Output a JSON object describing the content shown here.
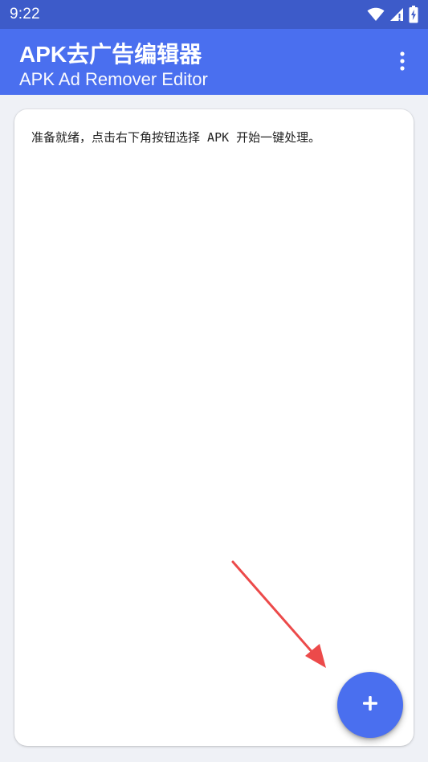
{
  "status_bar": {
    "time": "9:22",
    "icons": [
      "wifi-icon",
      "cellular-signal-icon",
      "battery-charging-icon"
    ]
  },
  "app_bar": {
    "title": "APK去广告编辑器",
    "subtitle": "APK Ad Remover Editor",
    "menu_icon": "more-vert-icon"
  },
  "main": {
    "status_message": "准备就绪，点击右下角按钮选择 APK 开始一键处理。"
  },
  "fab": {
    "icon": "plus-icon"
  },
  "colors": {
    "status_bar": "#3d5bc9",
    "app_bar": "#4a6fef",
    "background": "#eff1f6",
    "card": "#ffffff",
    "fab": "#4a6fef",
    "annotation_arrow": "#ec4a4a"
  }
}
